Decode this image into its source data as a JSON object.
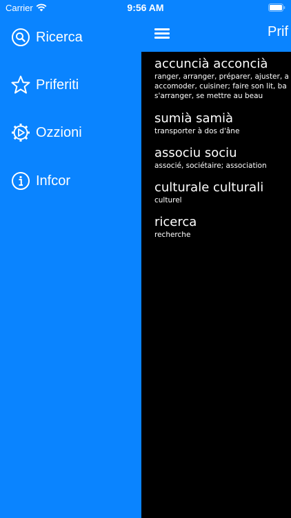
{
  "status_bar": {
    "carrier": "Carrier",
    "time": "9:56 AM",
    "icons": [
      "wifi-icon",
      "battery-icon"
    ]
  },
  "menu": {
    "items": [
      {
        "icon": "search-icon",
        "label": "Ricerca"
      },
      {
        "icon": "star-icon",
        "label": "Priferiti"
      },
      {
        "icon": "settings-gear-icon",
        "label": "Ozzioni"
      },
      {
        "icon": "info-icon",
        "label": "Infcor"
      }
    ]
  },
  "main": {
    "title": "Prif",
    "menu_icon": "hamburger-icon",
    "entries": [
      {
        "term": "accuncià acconcià",
        "definition": "ranger, arranger, préparer, ajuster, a\naccomoder, cuisiner; faire son lit, ba\ns'arranger, se mettre au beau"
      },
      {
        "term": "sumià  samià",
        "definition": "transporter à dos d'âne"
      },
      {
        "term": "associu sociu",
        "definition": "associé, sociétaire; association"
      },
      {
        "term": "culturale culturali",
        "definition": "culturel"
      },
      {
        "term": "ricerca",
        "definition": "recherche"
      }
    ]
  },
  "colors": {
    "accent": "#0a84ff",
    "list_background": "#000000",
    "text": "#ffffff"
  }
}
